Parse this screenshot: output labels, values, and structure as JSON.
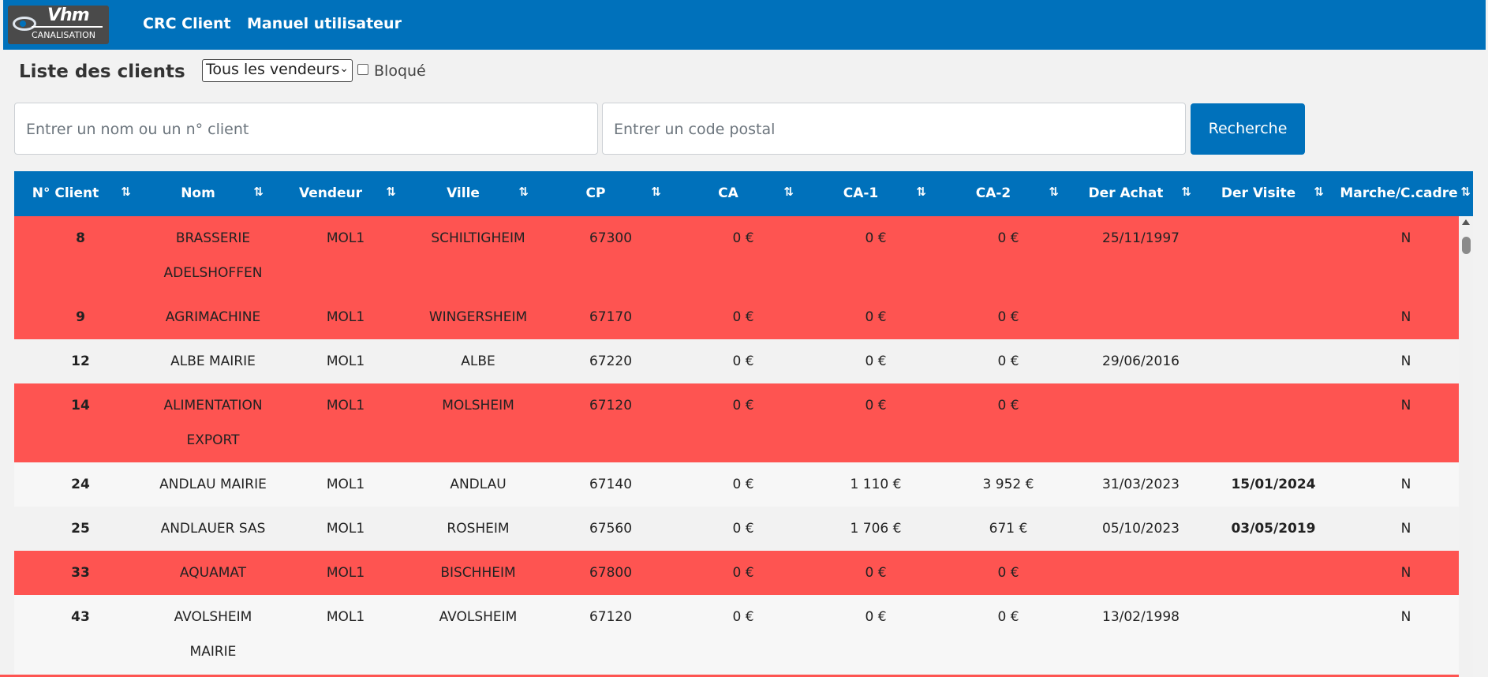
{
  "logo": {
    "title": "Vhm",
    "subtitle": "CANALISATION"
  },
  "nav": {
    "crc_client": "CRC Client",
    "manuel": "Manuel utilisateur"
  },
  "page": {
    "title": "Liste des clients"
  },
  "filters": {
    "vendeur_selected": "Tous les vendeurs",
    "bloque_label": "Bloqué",
    "bloque_checked": false,
    "name_placeholder": "Entrer un nom ou un n° client",
    "cp_placeholder": "Entrer un code postal",
    "search_button": "Recherche"
  },
  "table": {
    "sort_icon": "⇅",
    "columns": [
      "N° Client",
      "Nom",
      "Vendeur",
      "Ville",
      "CP",
      "CA",
      "CA-1",
      "CA-2",
      "Der Achat",
      "Der Visite",
      "Marche/C.cadre"
    ],
    "rows": [
      {
        "num": "8",
        "nom": "BRASSERIE ADELSHOFFEN",
        "vendeur": "MOL1",
        "ville": "SCHILTIGHEIM",
        "cp": "67300",
        "ca": "0 €",
        "ca1": "0 €",
        "ca2": "0 €",
        "der_achat": "25/11/1997",
        "der_visite": "",
        "marche": "N",
        "blocked": true
      },
      {
        "num": "9",
        "nom": "AGRIMACHINE",
        "vendeur": "MOL1",
        "ville": "WINGERSHEIM",
        "cp": "67170",
        "ca": "0 €",
        "ca1": "0 €",
        "ca2": "0 €",
        "der_achat": "",
        "der_visite": "",
        "marche": "N",
        "blocked": true
      },
      {
        "num": "12",
        "nom": "ALBE MAIRIE",
        "vendeur": "MOL1",
        "ville": "ALBE",
        "cp": "67220",
        "ca": "0 €",
        "ca1": "0 €",
        "ca2": "0 €",
        "der_achat": "29/06/2016",
        "der_visite": "",
        "marche": "N",
        "blocked": false
      },
      {
        "num": "14",
        "nom": "ALIMENTATION EXPORT",
        "vendeur": "MOL1",
        "ville": "MOLSHEIM",
        "cp": "67120",
        "ca": "0 €",
        "ca1": "0 €",
        "ca2": "0 €",
        "der_achat": "",
        "der_visite": "",
        "marche": "N",
        "blocked": true
      },
      {
        "num": "24",
        "nom": "ANDLAU MAIRIE",
        "vendeur": "MOL1",
        "ville": "ANDLAU",
        "cp": "67140",
        "ca": "0 €",
        "ca1": "1 110 €",
        "ca2": "3 952 €",
        "der_achat": "31/03/2023",
        "der_visite": "15/01/2024",
        "marche": "N",
        "blocked": false
      },
      {
        "num": "25",
        "nom": "ANDLAUER SAS",
        "vendeur": "MOL1",
        "ville": "ROSHEIM",
        "cp": "67560",
        "ca": "0 €",
        "ca1": "1 706 €",
        "ca2": "671 €",
        "der_achat": "05/10/2023",
        "der_visite": "03/05/2019",
        "marche": "N",
        "blocked": false
      },
      {
        "num": "33",
        "nom": "AQUAMAT",
        "vendeur": "MOL1",
        "ville": "BISCHHEIM",
        "cp": "67800",
        "ca": "0 €",
        "ca1": "0 €",
        "ca2": "0 €",
        "der_achat": "",
        "der_visite": "",
        "marche": "N",
        "blocked": true
      },
      {
        "num": "43",
        "nom": "AVOLSHEIM MAIRIE",
        "vendeur": "MOL1",
        "ville": "AVOLSHEIM",
        "cp": "67120",
        "ca": "0 €",
        "ca1": "0 €",
        "ca2": "0 €",
        "der_achat": "13/02/1998",
        "der_visite": "",
        "marche": "N",
        "blocked": false
      }
    ]
  },
  "colors": {
    "primary": "#0071bb",
    "blocked_row": "#fe5451"
  }
}
